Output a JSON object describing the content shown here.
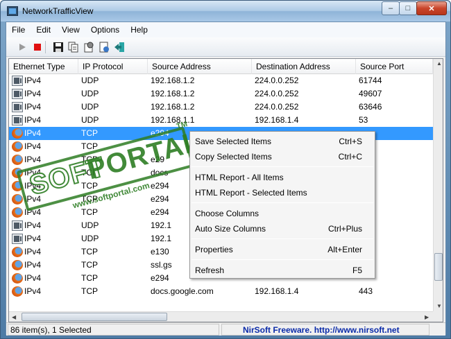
{
  "window": {
    "title": "NetworkTrafficView"
  },
  "menu": [
    "File",
    "Edit",
    "View",
    "Options",
    "Help"
  ],
  "toolbar": {
    "icons": [
      "play-icon",
      "stop-icon",
      "save-icon",
      "copy-icon",
      "properties-icon",
      "html-report-icon",
      "exit-icon"
    ]
  },
  "columns": [
    "Ethernet Type",
    "IP Protocol",
    "Source Address",
    "Destination Address",
    "Source Port"
  ],
  "rows": [
    {
      "icon": "network-adapter",
      "eth": "IPv4",
      "proto": "UDP",
      "src": "192.168.1.2",
      "dst": "224.0.0.252",
      "port": "61744"
    },
    {
      "icon": "network-adapter",
      "eth": "IPv4",
      "proto": "UDP",
      "src": "192.168.1.2",
      "dst": "224.0.0.252",
      "port": "49607"
    },
    {
      "icon": "network-adapter",
      "eth": "IPv4",
      "proto": "UDP",
      "src": "192.168.1.2",
      "dst": "224.0.0.252",
      "port": "63646"
    },
    {
      "icon": "network-adapter",
      "eth": "IPv4",
      "proto": "UDP",
      "src": "192.168.1.1",
      "dst": "192.168.1.4",
      "port": "53"
    },
    {
      "icon": "firefox",
      "eth": "IPv4",
      "proto": "TCP",
      "src": "e294",
      "dst": "",
      "port": "",
      "selected": true
    },
    {
      "icon": "firefox",
      "eth": "IPv4",
      "proto": "TCP",
      "src": "",
      "dst": "",
      "port": ""
    },
    {
      "icon": "firefox",
      "eth": "IPv4",
      "proto": "TCP",
      "src": "e29",
      "dst": "",
      "port": ""
    },
    {
      "icon": "firefox",
      "eth": "IPv4",
      "proto": "TCP",
      "src": "docs",
      "dst": "",
      "port": ""
    },
    {
      "icon": "firefox",
      "eth": "IPv4",
      "proto": "TCP",
      "src": "e294",
      "dst": "",
      "port": ""
    },
    {
      "icon": "firefox",
      "eth": "IPv4",
      "proto": "TCP",
      "src": "e294",
      "dst": "",
      "port": ""
    },
    {
      "icon": "firefox",
      "eth": "IPv4",
      "proto": "TCP",
      "src": "e294",
      "dst": "",
      "port": ""
    },
    {
      "icon": "network-adapter",
      "eth": "IPv4",
      "proto": "UDP",
      "src": "192.1",
      "dst": "",
      "port": ""
    },
    {
      "icon": "network-adapter",
      "eth": "IPv4",
      "proto": "UDP",
      "src": "192.1",
      "dst": "",
      "port": ""
    },
    {
      "icon": "firefox",
      "eth": "IPv4",
      "proto": "TCP",
      "src": "e130",
      "dst": "",
      "port": ""
    },
    {
      "icon": "firefox",
      "eth": "IPv4",
      "proto": "TCP",
      "src": "ssl.gs",
      "dst": "",
      "port": ""
    },
    {
      "icon": "firefox",
      "eth": "IPv4",
      "proto": "TCP",
      "src": "e294",
      "dst": "",
      "port": ""
    },
    {
      "icon": "firefox",
      "eth": "IPv4",
      "proto": "TCP",
      "src": "docs.google.com",
      "dst": "192.168.1.4",
      "port": "443"
    }
  ],
  "context_menu": {
    "groups": [
      [
        {
          "label": "Save Selected Items",
          "shortcut": "Ctrl+S"
        },
        {
          "label": "Copy Selected Items",
          "shortcut": "Ctrl+C"
        }
      ],
      [
        {
          "label": "HTML Report - All Items",
          "shortcut": ""
        },
        {
          "label": "HTML Report - Selected Items",
          "shortcut": ""
        }
      ],
      [
        {
          "label": "Choose Columns",
          "shortcut": ""
        },
        {
          "label": "Auto Size Columns",
          "shortcut": "Ctrl+Plus"
        }
      ],
      [
        {
          "label": "Properties",
          "shortcut": "Alt+Enter"
        }
      ],
      [
        {
          "label": "Refresh",
          "shortcut": "F5"
        }
      ]
    ]
  },
  "status": {
    "count": "86 item(s), 1 Selected",
    "credit": "NirSoft Freeware.  http://www.nirsoft.net"
  },
  "watermark": {
    "brand": "SOFTPORTAL",
    "url": "www.softportal.com",
    "tm": "TM"
  }
}
